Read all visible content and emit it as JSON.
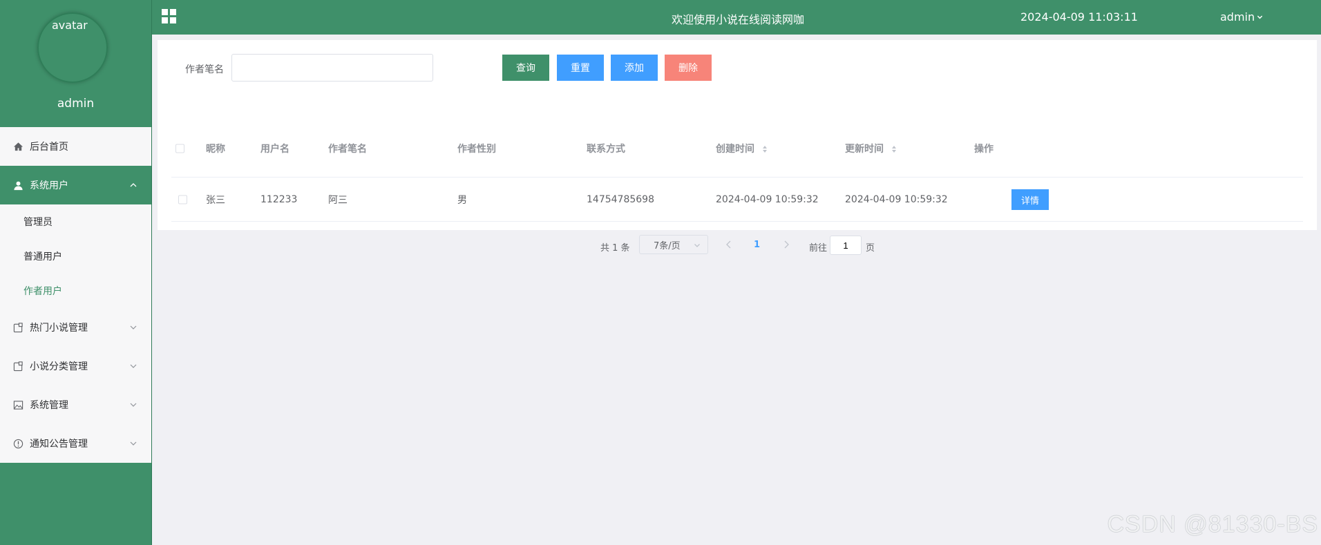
{
  "sidebar": {
    "avatar_alt": "avatar",
    "username": "admin",
    "menu": [
      {
        "label": "后台首页",
        "icon": "home-icon"
      },
      {
        "label": "系统用户",
        "icon": "user-icon"
      },
      {
        "label": "热门小说管理",
        "icon": "document-icon"
      },
      {
        "label": "小说分类管理",
        "icon": "document-icon"
      },
      {
        "label": "系统管理",
        "icon": "image-icon"
      },
      {
        "label": "通知公告管理",
        "icon": "info-icon"
      }
    ],
    "submenu": [
      "管理员",
      "普通用户",
      "作者用户"
    ]
  },
  "header": {
    "title": "欢迎使用小说在线阅读网咖",
    "datetime": "2024-04-09 11:03:11",
    "user": "admin"
  },
  "search": {
    "label": "作者笔名",
    "value": "",
    "placeholder": "",
    "buttons": {
      "query": "查询",
      "reset": "重置",
      "add": "添加",
      "delete": "删除"
    }
  },
  "table": {
    "columns": [
      "昵称",
      "用户名",
      "作者笔名",
      "作者性别",
      "联系方式",
      "创建时间",
      "更新时间",
      "操作"
    ],
    "rows": [
      {
        "nickname": "张三",
        "username": "112233",
        "pen_name": "阿三",
        "gender": "男",
        "contact": "14754785698",
        "created": "2024-04-09 10:59:32",
        "updated": "2024-04-09 10:59:32",
        "action": "详情"
      }
    ]
  },
  "pagination": {
    "total_text": "共 1 条",
    "page_size": "7条/页",
    "current_page": "1",
    "goto_label": "前往",
    "goto_value": "1",
    "page_unit": "页"
  },
  "watermark": "CSDN @81330-BS",
  "colors": {
    "primary": "#3f906a",
    "blue": "#409eff",
    "danger": "#f78479"
  }
}
